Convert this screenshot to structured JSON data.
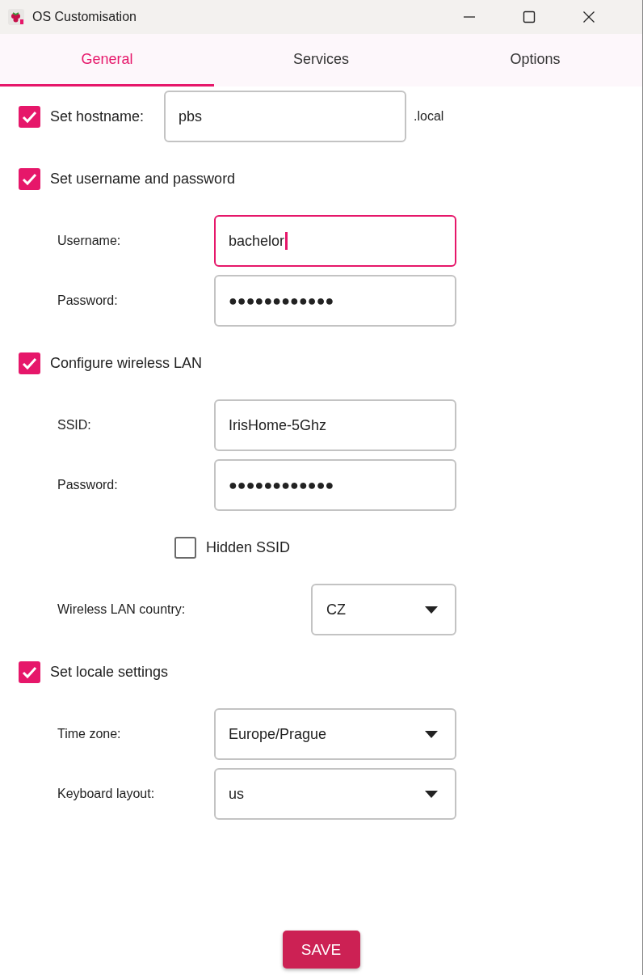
{
  "window": {
    "title": "OS Customisation"
  },
  "tabs": [
    {
      "label": "General",
      "selected": true
    },
    {
      "label": "Services",
      "selected": false
    },
    {
      "label": "Options",
      "selected": false
    }
  ],
  "rows": [
    {
      "kind": "checkbox-field",
      "label": "Set hostname:",
      "checked": true,
      "value": "pbs",
      "suffix": ".local"
    },
    {
      "kind": "checkbox",
      "label": "Set username and password",
      "checked": true
    },
    {
      "kind": "field",
      "label": "Username:",
      "value": "bachelor",
      "focused": true
    },
    {
      "kind": "field",
      "label": "Password:",
      "value": "●●●●●●●●●●●●",
      "focused": false
    },
    {
      "kind": "checkbox",
      "label": "Configure wireless LAN",
      "checked": true
    },
    {
      "kind": "field",
      "label": "SSID:",
      "value": "IrisHome-5Ghz",
      "focused": false
    },
    {
      "kind": "field",
      "label": "Password:",
      "value": "●●●●●●●●●●●●",
      "focused": false
    },
    {
      "kind": "small-checkbox",
      "label": "Hidden SSID",
      "checked": false
    },
    {
      "kind": "narrow-dropdown",
      "label": "Wireless LAN country:",
      "value": "CZ"
    },
    {
      "kind": "checkbox",
      "label": "Set locale settings",
      "checked": true
    },
    {
      "kind": "dropdown",
      "label": "Time zone:",
      "value": "Europe/Prague"
    },
    {
      "kind": "dropdown",
      "label": "Keyboard layout:",
      "value": "us"
    }
  ],
  "save_button": "SAVE"
}
